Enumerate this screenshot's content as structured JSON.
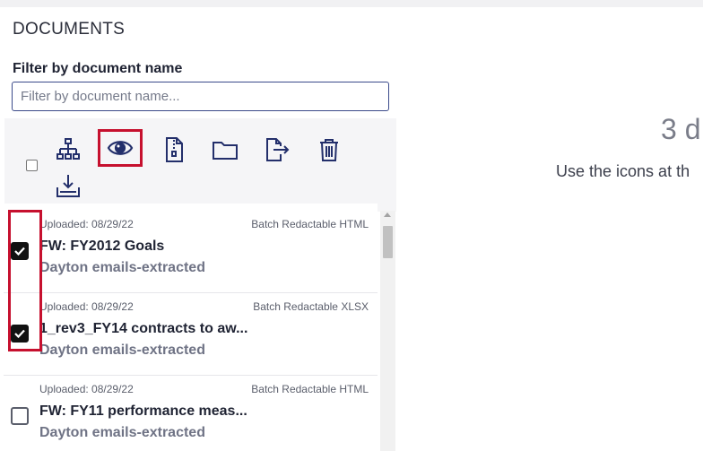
{
  "section": {
    "title": "DOCUMENTS"
  },
  "filter": {
    "label": "Filter by document name",
    "placeholder": "Filter by document name..."
  },
  "toolbar": {
    "icons": [
      {
        "name": "hierarchy-icon"
      },
      {
        "name": "eye-icon",
        "highlighted": true
      },
      {
        "name": "zip-file-icon"
      },
      {
        "name": "folder-icon"
      },
      {
        "name": "export-file-icon"
      },
      {
        "name": "trash-icon"
      },
      {
        "name": "download-icon"
      }
    ],
    "accent_color": "#232f6b",
    "highlight_color": "#c6102e"
  },
  "documents": [
    {
      "uploaded": "Uploaded: 08/29/22",
      "type": "Batch Redactable HTML",
      "name": "FW: FY2012 Goals",
      "source": "Dayton emails-extracted",
      "checked": true
    },
    {
      "uploaded": "Uploaded: 08/29/22",
      "type": "Batch Redactable XLSX",
      "name": "1_rev3_FY14 contracts to aw...",
      "source": "Dayton emails-extracted",
      "checked": true
    },
    {
      "uploaded": "Uploaded: 08/29/22",
      "type": "Batch Redactable HTML",
      "name": "FW: FY11 performance meas...",
      "source": "Dayton emails-extracted",
      "checked": false
    }
  ],
  "right_panel": {
    "count_text": "3 d",
    "hint_text": "Use the icons at th"
  }
}
